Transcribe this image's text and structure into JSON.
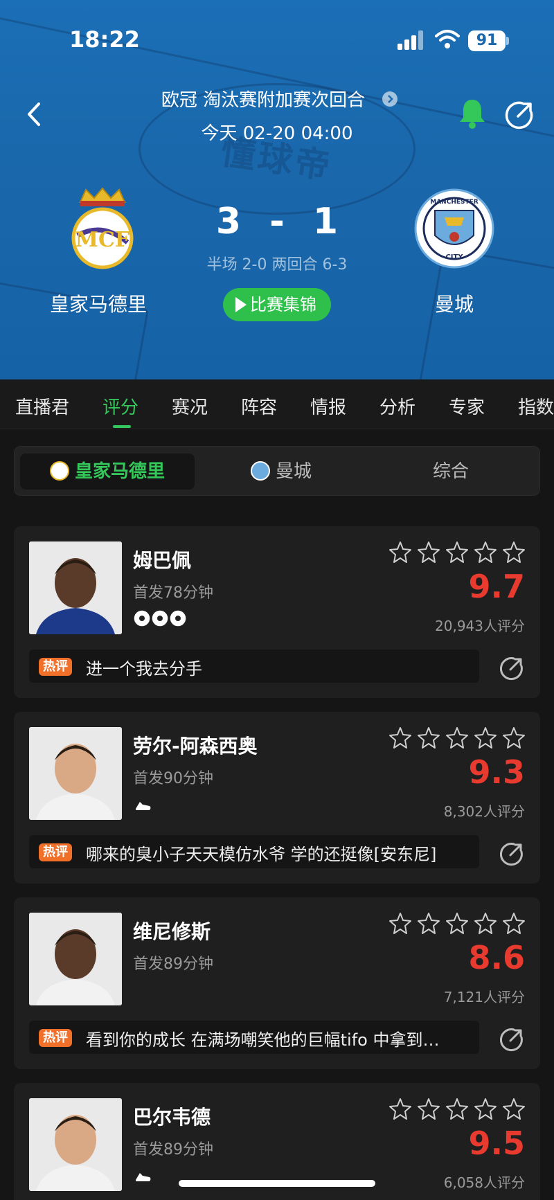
{
  "status_bar": {
    "time": "18:22",
    "battery": "91"
  },
  "header": {
    "competition": "欧冠 淘汰赛附加赛次回合",
    "match_time": "今天 02-20 04:00",
    "watermark": "懂球帝",
    "home_team": "皇家马德里",
    "away_team": "曼城",
    "home_score": "3",
    "separator": "-",
    "away_score": "1",
    "aggregate": "半场 2-0 两回合 6-3",
    "highlights_label": "比赛集锦"
  },
  "tabs": [
    "直播君",
    "评分",
    "赛况",
    "阵容",
    "情报",
    "分析",
    "专家",
    "指数"
  ],
  "active_tab": "评分",
  "segments": [
    "皇家马德里",
    "曼城",
    "综合"
  ],
  "hot_label": "热评",
  "players": [
    {
      "name": "姆巴佩",
      "minutes": "首发78分钟",
      "event": "goals-3",
      "rating": "9.7",
      "votes": "20,943人评分",
      "comment": "进一个我去分手"
    },
    {
      "name": "劳尔-阿森西奥",
      "minutes": "首发90分钟",
      "event": "boot",
      "rating": "9.3",
      "votes": "8,302人评分",
      "comment": "哪来的臭小子天天模仿水爷 学的还挺像[安东尼]"
    },
    {
      "name": "维尼修斯",
      "minutes": "首发89分钟",
      "event": "",
      "rating": "8.6",
      "votes": "7,121人评分",
      "comment": "看到你的成长 在满场嘲笑他的巨幅tifo 中拿到…"
    },
    {
      "name": "巴尔韦德",
      "minutes": "首发89分钟",
      "event": "boot",
      "rating": "9.5",
      "votes": "6,058人评分",
      "comment": ""
    }
  ],
  "colors": {
    "accent_green": "#34c759",
    "rating_red": "#e83a2e",
    "hot_orange": "#f0702a",
    "header_blue": "#1a67ab"
  }
}
